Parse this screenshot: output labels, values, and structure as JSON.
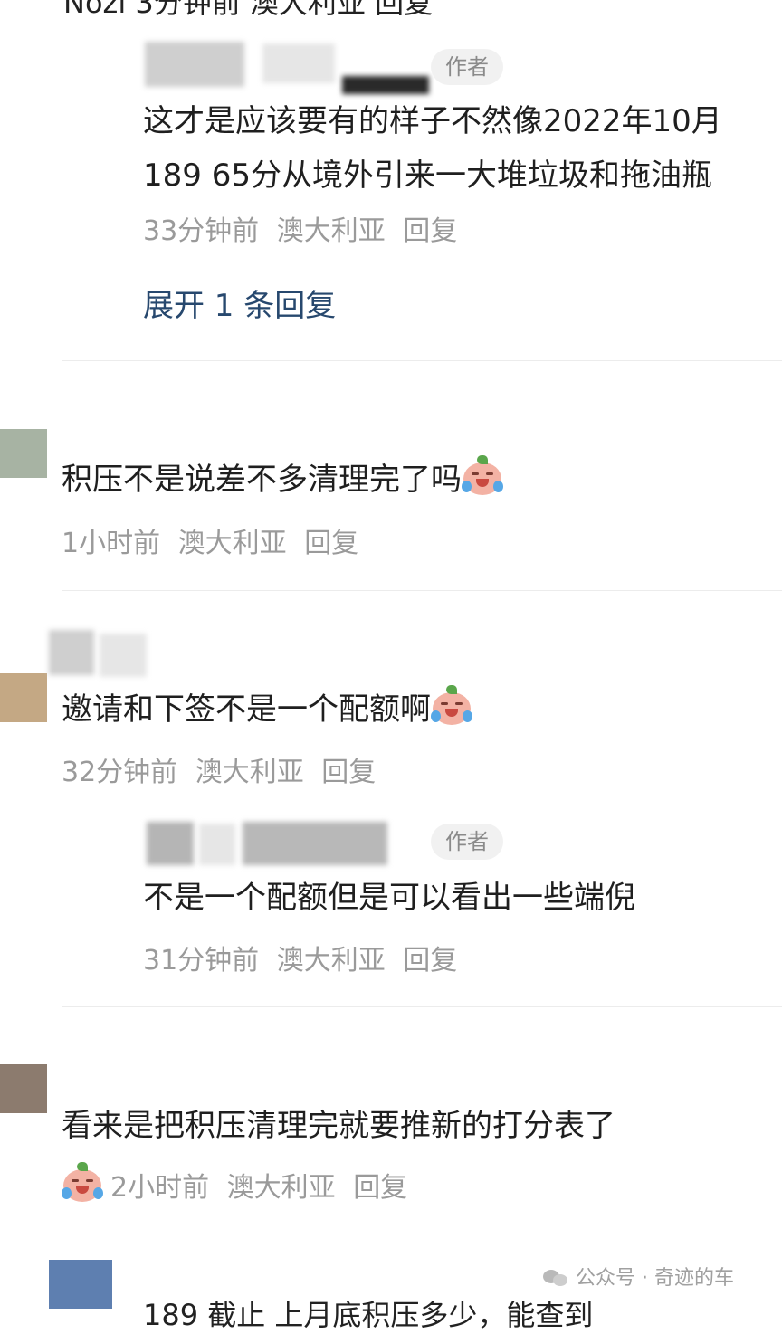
{
  "top_cut_text": "Nozi 3分钟前 澳大利亚 回复",
  "thread": [
    {
      "author_tag": "作者",
      "text": "这才是应该要有的样子不然像2022年10月189 65分从境外引来一大堆垃圾和拖油瓶",
      "time": "33分钟前",
      "location": "澳大利亚",
      "reply": "回复",
      "expand": "展开 1 条回复"
    }
  ],
  "comments": [
    {
      "text": "积压不是说差不多清理完了吗",
      "emoji": "crying-laughing-emoji",
      "time": "1小时前",
      "location": "澳大利亚",
      "reply": "回复"
    },
    {
      "text": "邀请和下签不是一个配额啊",
      "emoji": "crying-laughing-emoji",
      "time": "32分钟前",
      "location": "澳大利亚",
      "reply": "回复",
      "author_reply": {
        "author_tag": "作者",
        "text": "不是一个配额但是可以看出一些端倪",
        "time": "31分钟前",
        "location": "澳大利亚",
        "reply": "回复"
      }
    },
    {
      "text": "看来是把积压清理完就要推新的打分表了",
      "emoji": "crying-laughing-emoji",
      "time": "2小时前",
      "location": "澳大利亚",
      "reply": "回复"
    }
  ],
  "bottom_cut_text": "189 截止 上月底积压多少，能查到",
  "watermark": "公众号 · 奇迹的车"
}
